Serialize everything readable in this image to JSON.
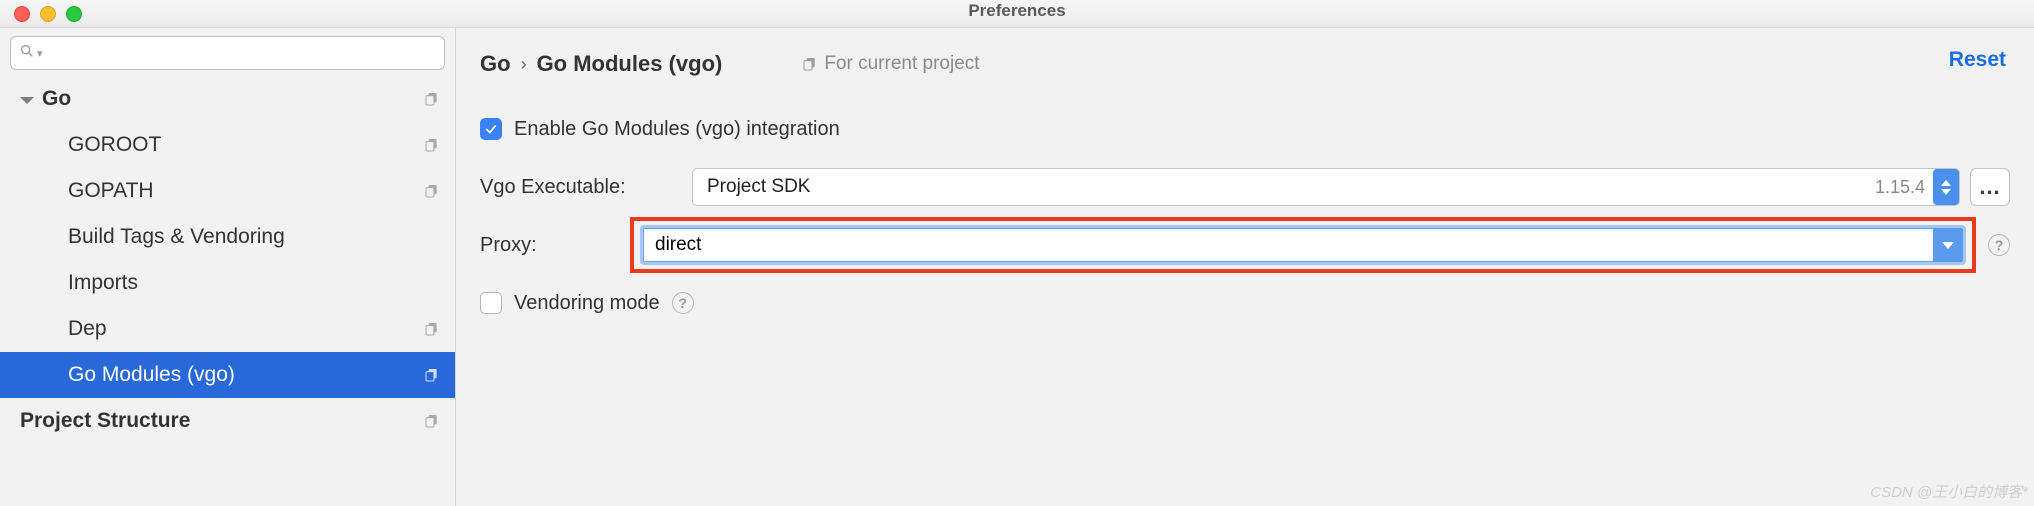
{
  "window": {
    "title": "Preferences"
  },
  "sidebar": {
    "items": [
      {
        "label": "Go",
        "bold": true,
        "expandable": true
      },
      {
        "label": "GOROOT"
      },
      {
        "label": "GOPATH"
      },
      {
        "label": "Build Tags & Vendoring"
      },
      {
        "label": "Imports"
      },
      {
        "label": "Dep"
      },
      {
        "label": "Go Modules (vgo)",
        "selected": true
      },
      {
        "label": "Project Structure",
        "bold": true
      }
    ]
  },
  "breadcrumb": {
    "root": "Go",
    "leaf": "Go Modules (vgo)",
    "sep": "›"
  },
  "scope_label": "For current project",
  "reset_label": "Reset",
  "form": {
    "enable_label": "Enable Go Modules (vgo) integration",
    "enable_checked": true,
    "vgo_exec_label": "Vgo Executable:",
    "vgo_exec_value": "Project SDK",
    "vgo_exec_version": "1.15.4",
    "more_label": "...",
    "proxy_label": "Proxy:",
    "proxy_value": "direct",
    "vendoring_label": "Vendoring mode",
    "vendoring_checked": false
  },
  "icons": {
    "search": "search-icon",
    "copy": "copy-icon",
    "help": "?"
  },
  "watermark": "CSDN @王小白的博客*"
}
